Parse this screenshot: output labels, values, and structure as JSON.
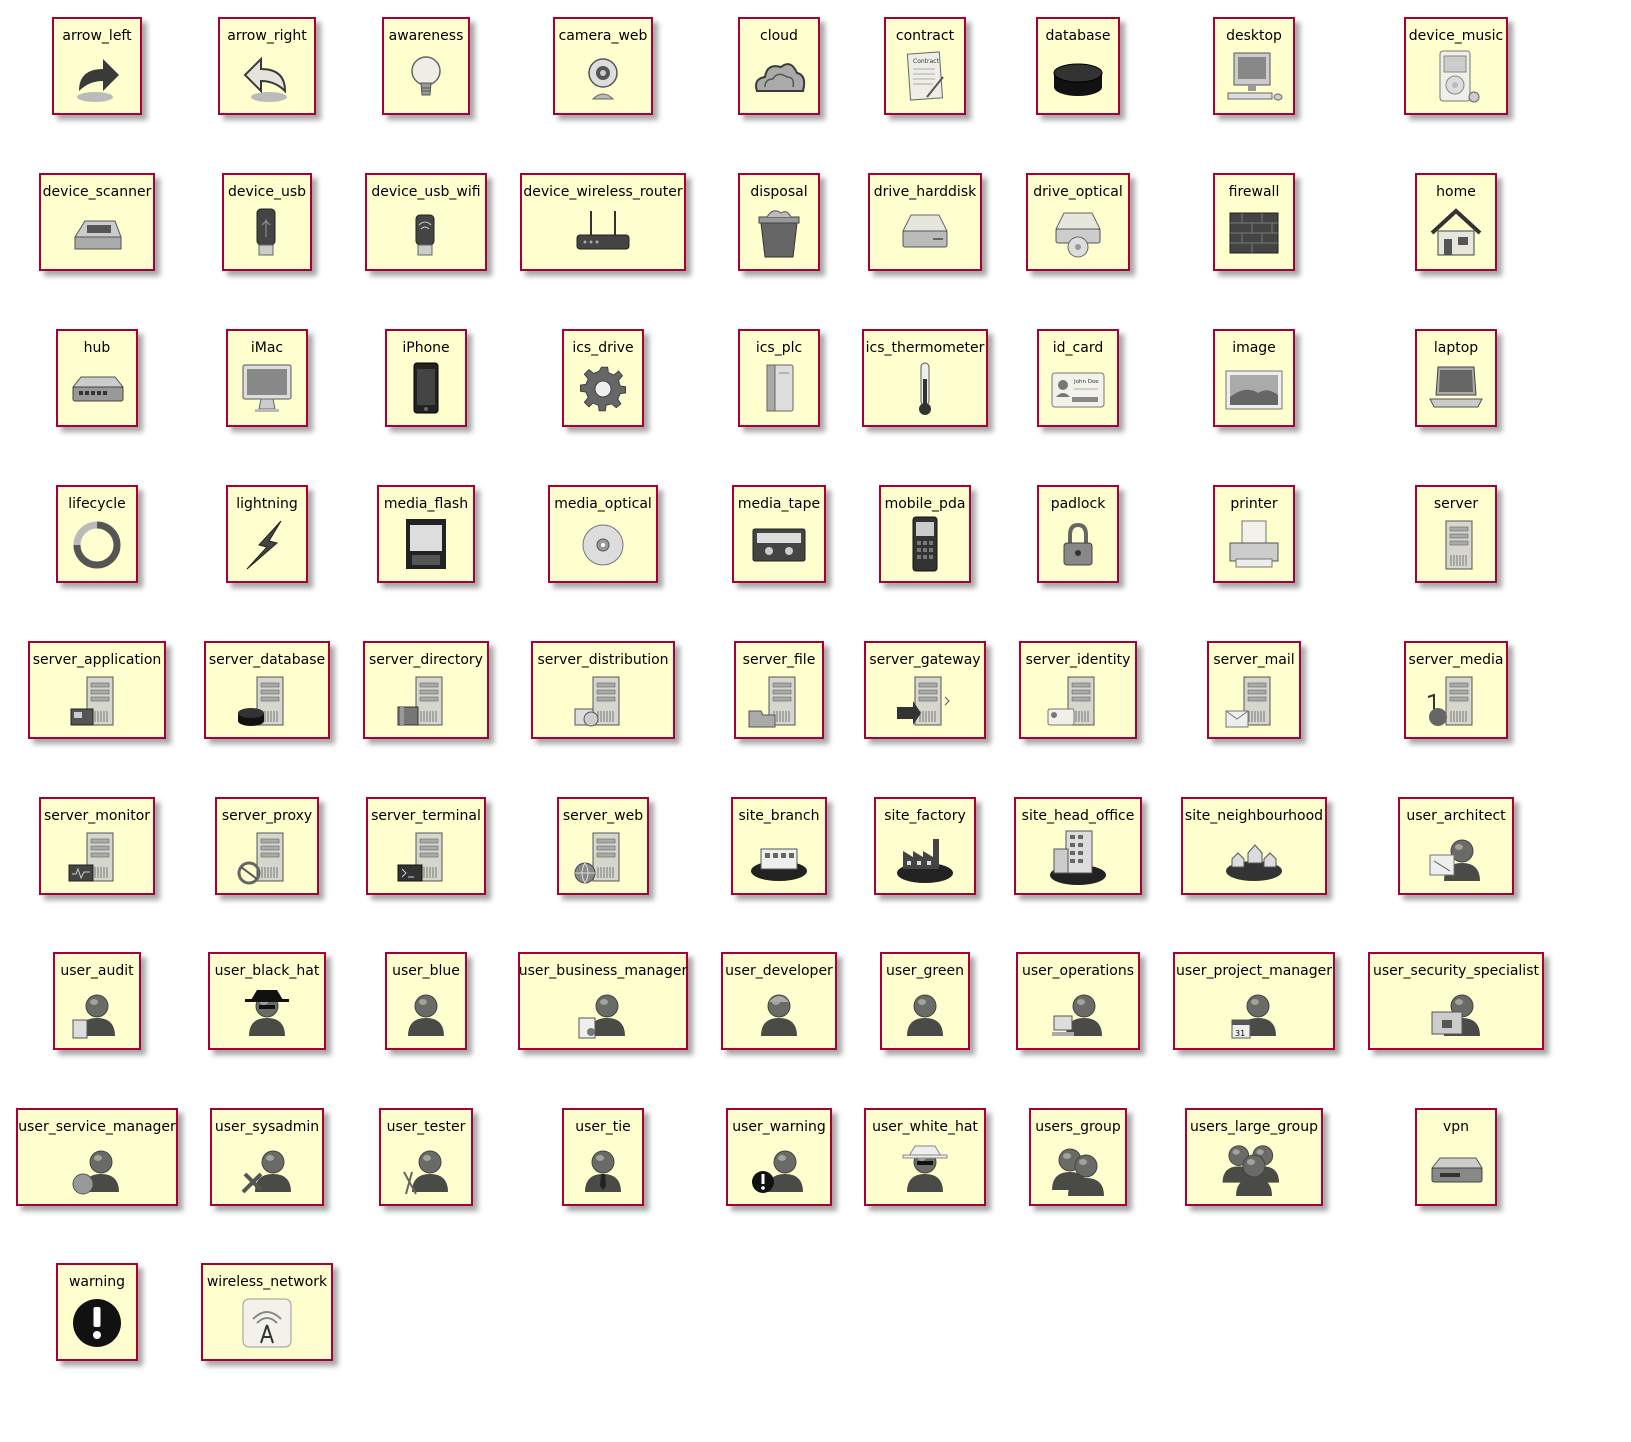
{
  "colors": {
    "node_fill": "#FEFECE",
    "node_border": "#A80036",
    "icon_ink": "#3a3a3a"
  },
  "nodes": [
    {
      "label": "arrow_left",
      "icon": "arrow-left-icon"
    },
    {
      "label": "arrow_right",
      "icon": "arrow-right-icon"
    },
    {
      "label": "awareness",
      "icon": "lightbulb-icon"
    },
    {
      "label": "camera_web",
      "icon": "webcam-icon"
    },
    {
      "label": "cloud",
      "icon": "cloud-icon"
    },
    {
      "label": "contract",
      "icon": "contract-icon"
    },
    {
      "label": "database",
      "icon": "database-icon"
    },
    {
      "label": "desktop",
      "icon": "desktop-icon"
    },
    {
      "label": "device_music",
      "icon": "music-player-icon"
    },
    {
      "label": "device_scanner",
      "icon": "scanner-icon"
    },
    {
      "label": "device_usb",
      "icon": "usb-stick-icon"
    },
    {
      "label": "device_usb_wifi",
      "icon": "usb-wifi-icon"
    },
    {
      "label": "device_wireless_router",
      "icon": "router-icon"
    },
    {
      "label": "disposal",
      "icon": "trash-icon"
    },
    {
      "label": "drive_harddisk",
      "icon": "harddisk-icon"
    },
    {
      "label": "drive_optical",
      "icon": "optical-drive-icon"
    },
    {
      "label": "firewall",
      "icon": "firewall-icon"
    },
    {
      "label": "home",
      "icon": "home-icon"
    },
    {
      "label": "hub",
      "icon": "hub-icon"
    },
    {
      "label": "iMac",
      "icon": "imac-icon"
    },
    {
      "label": "iPhone",
      "icon": "phone-icon"
    },
    {
      "label": "ics_drive",
      "icon": "gear-icon"
    },
    {
      "label": "ics_plc",
      "icon": "plc-icon"
    },
    {
      "label": "ics_thermometer",
      "icon": "thermometer-icon"
    },
    {
      "label": "id_card",
      "icon": "id-card-icon"
    },
    {
      "label": "image",
      "icon": "image-icon"
    },
    {
      "label": "laptop",
      "icon": "laptop-icon"
    },
    {
      "label": "lifecycle",
      "icon": "lifecycle-icon"
    },
    {
      "label": "lightning",
      "icon": "lightning-icon"
    },
    {
      "label": "media_flash",
      "icon": "flash-card-icon"
    },
    {
      "label": "media_optical",
      "icon": "disc-icon"
    },
    {
      "label": "media_tape",
      "icon": "tape-icon"
    },
    {
      "label": "mobile_pda",
      "icon": "pda-icon"
    },
    {
      "label": "padlock",
      "icon": "padlock-icon"
    },
    {
      "label": "printer",
      "icon": "printer-icon"
    },
    {
      "label": "server",
      "icon": "server-icon"
    },
    {
      "label": "server_application",
      "icon": "server-application-icon"
    },
    {
      "label": "server_database",
      "icon": "server-database-icon"
    },
    {
      "label": "server_directory",
      "icon": "server-directory-icon"
    },
    {
      "label": "server_distribution",
      "icon": "server-distribution-icon"
    },
    {
      "label": "server_file",
      "icon": "server-file-icon"
    },
    {
      "label": "server_gateway",
      "icon": "server-gateway-icon"
    },
    {
      "label": "server_identity",
      "icon": "server-identity-icon"
    },
    {
      "label": "server_mail",
      "icon": "server-mail-icon"
    },
    {
      "label": "server_media",
      "icon": "server-media-icon"
    },
    {
      "label": "server_monitor",
      "icon": "server-monitor-icon"
    },
    {
      "label": "server_proxy",
      "icon": "server-proxy-icon"
    },
    {
      "label": "server_terminal",
      "icon": "server-terminal-icon"
    },
    {
      "label": "server_web",
      "icon": "server-web-icon"
    },
    {
      "label": "site_branch",
      "icon": "site-branch-icon"
    },
    {
      "label": "site_factory",
      "icon": "site-factory-icon"
    },
    {
      "label": "site_head_office",
      "icon": "site-head-office-icon"
    },
    {
      "label": "site_neighbourhood",
      "icon": "site-neighbourhood-icon"
    },
    {
      "label": "user_architect",
      "icon": "user-architect-icon"
    },
    {
      "label": "user_audit",
      "icon": "user-audit-icon"
    },
    {
      "label": "user_black_hat",
      "icon": "user-black-hat-icon"
    },
    {
      "label": "user_blue",
      "icon": "user-icon"
    },
    {
      "label": "user_business_manager",
      "icon": "user-business-manager-icon"
    },
    {
      "label": "user_developer",
      "icon": "user-developer-icon"
    },
    {
      "label": "user_green",
      "icon": "user-icon"
    },
    {
      "label": "user_operations",
      "icon": "user-operations-icon"
    },
    {
      "label": "user_project_manager",
      "icon": "user-project-manager-icon"
    },
    {
      "label": "user_security_specialist",
      "icon": "user-security-specialist-icon"
    },
    {
      "label": "user_service_manager",
      "icon": "user-service-manager-icon"
    },
    {
      "label": "user_sysadmin",
      "icon": "user-sysadmin-icon"
    },
    {
      "label": "user_tester",
      "icon": "user-tester-icon"
    },
    {
      "label": "user_tie",
      "icon": "user-tie-icon"
    },
    {
      "label": "user_warning",
      "icon": "user-warning-icon"
    },
    {
      "label": "user_white_hat",
      "icon": "user-white-hat-icon"
    },
    {
      "label": "users_group",
      "icon": "users-group-icon"
    },
    {
      "label": "users_large_group",
      "icon": "users-large-group-icon"
    },
    {
      "label": "vpn",
      "icon": "vpn-icon"
    },
    {
      "label": "warning",
      "icon": "warning-icon"
    },
    {
      "label": "wireless_network",
      "icon": "wireless-network-icon"
    }
  ]
}
